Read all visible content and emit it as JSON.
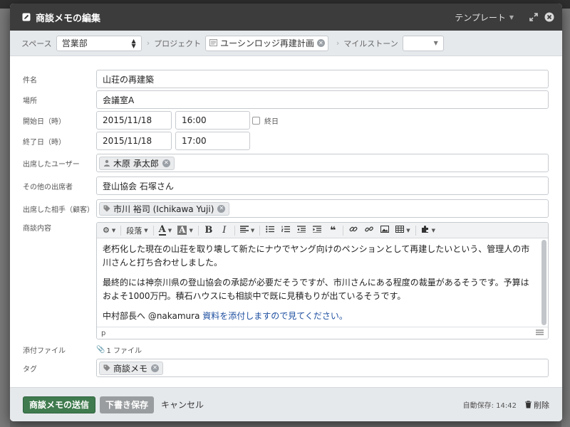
{
  "modal": {
    "title": "商談メモの編集",
    "template_label": "テンプレート"
  },
  "context": {
    "space_label": "スペース",
    "space_value": "営業部",
    "project_label": "プロジェクト",
    "project_value": "ユーシンロッジ再建計画",
    "milestone_label": "マイルストーン",
    "milestone_value": ""
  },
  "fields": {
    "subject_label": "件名",
    "subject_value": "山荘の再建築",
    "location_label": "場所",
    "location_value": "会議室A",
    "start_label": "開始日（時）",
    "start_date": "2015/11/18",
    "start_time": "16:00",
    "allday_label": "終日",
    "end_label": "終了日（時）",
    "end_date": "2015/11/18",
    "end_time": "17:00",
    "attendees_label": "出席したユーザー",
    "attendee_chip": "木原 承太郎",
    "others_label": "その他の出席者",
    "others_value": "登山協会 石塚さん",
    "client_label": "出席した相手（顧客）",
    "client_chip": "市川 裕司 (Ichikawa Yuji)",
    "content_label": "商談内容",
    "attach_label": "添付ファイル",
    "attach_value": "1 ファイル",
    "tags_label": "タグ",
    "tag_chip": "商談メモ"
  },
  "editor": {
    "toolbar": {
      "paragraph_label": "段落"
    },
    "paragraphs": [
      "老朽化した現在の山荘を取り壊して新たにナウでヤング向けのペンションとして再建したいという、管理人の市川さんと打ち合わせしました。",
      "最終的には神奈川県の登山協会の承認が必要だそうですが、市川さんにある程度の裁量があるそうです。予算はおよそ1000万円。積石ハウスにも相談中で既に見積もりが出ているそうです。"
    ],
    "line3_prefix": "中村部長へ @nakamura ",
    "line3_accent": "資料を添付しますので見てください。",
    "status_path": "p"
  },
  "footer": {
    "submit_label": "商談メモの送信",
    "draft_label": "下書き保存",
    "cancel_label": "キャンセル",
    "autosave_text": "自動保存: 14:42",
    "delete_label": "削除"
  },
  "colors": {
    "header_bg": "#3c3c3c",
    "primary_button": "#3f7b4e",
    "secondary_button": "#9a9d9f",
    "link_accent": "#1e4fa0"
  }
}
